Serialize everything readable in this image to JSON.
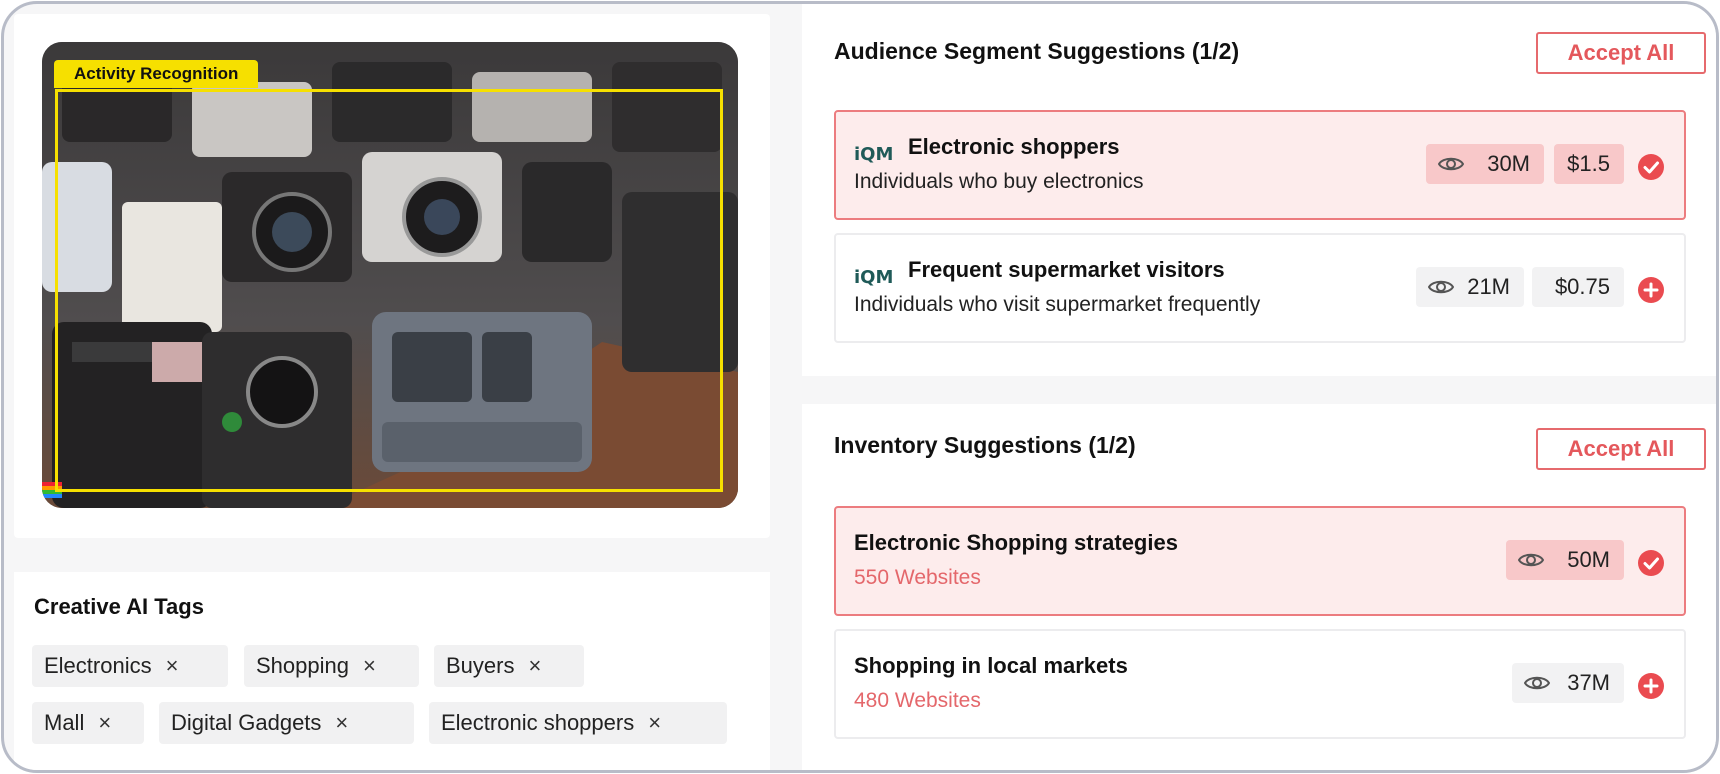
{
  "creative": {
    "detection_label": "Activity Recognition",
    "tags_title": "Creative AI Tags",
    "tags": [
      {
        "label": "Electronics"
      },
      {
        "label": "Shopping"
      },
      {
        "label": "Buyers"
      },
      {
        "label": "Mall"
      },
      {
        "label": "Digital Gadgets"
      },
      {
        "label": "Electronic shoppers"
      }
    ],
    "remove_glyph": "×"
  },
  "audience": {
    "title": "Audience Segment Suggestions (1/2)",
    "accept_all_label": "Accept All",
    "items": [
      {
        "provider_logo": "iQM",
        "name": "Electronic shoppers",
        "description": "Individuals who buy electronics",
        "reach": "30M",
        "price": "$1.5",
        "status": "accepted"
      },
      {
        "provider_logo": "iQM",
        "name": "Frequent supermarket visitors",
        "description": "Individuals who visit supermarket frequently",
        "reach": "21M",
        "price": "$0.75",
        "status": "suggested"
      }
    ]
  },
  "inventory": {
    "title": "Inventory Suggestions (1/2)",
    "accept_all_label": "Accept All",
    "items": [
      {
        "name": "Electronic Shopping strategies",
        "websites": "550 Websites",
        "reach": "50M",
        "status": "accepted"
      },
      {
        "name": "Shopping in local markets",
        "websites": "480 Websites",
        "reach": "37M",
        "status": "suggested"
      }
    ]
  },
  "colors": {
    "accent_red": "#ea4b50",
    "selected_bg": "#fdecec",
    "detection_yellow": "#f6e000",
    "brand_teal": "#1f5a58"
  },
  "icons": {
    "reach": "eye-icon",
    "accepted": "check-circle-icon",
    "suggested": "plus-circle-icon",
    "remove_tag": "close-icon"
  }
}
